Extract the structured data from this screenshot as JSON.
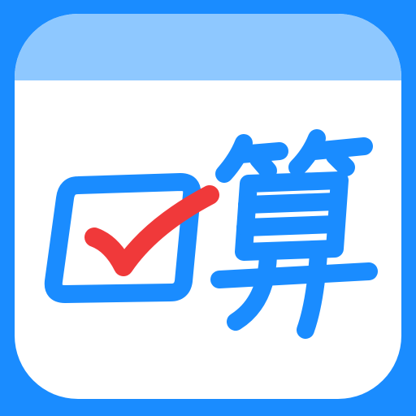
{
  "app": {
    "glyph": "口算"
  },
  "colors": {
    "background": "#1a8cff",
    "card": "#ffffff",
    "card_header": "#8ec8ff",
    "brand_blue": "#1a8cff",
    "check_red": "#f0393a"
  },
  "icons": {
    "checkbox": "checkbox-icon",
    "check": "checkmark-icon",
    "calc_char": "suan-character-icon"
  }
}
